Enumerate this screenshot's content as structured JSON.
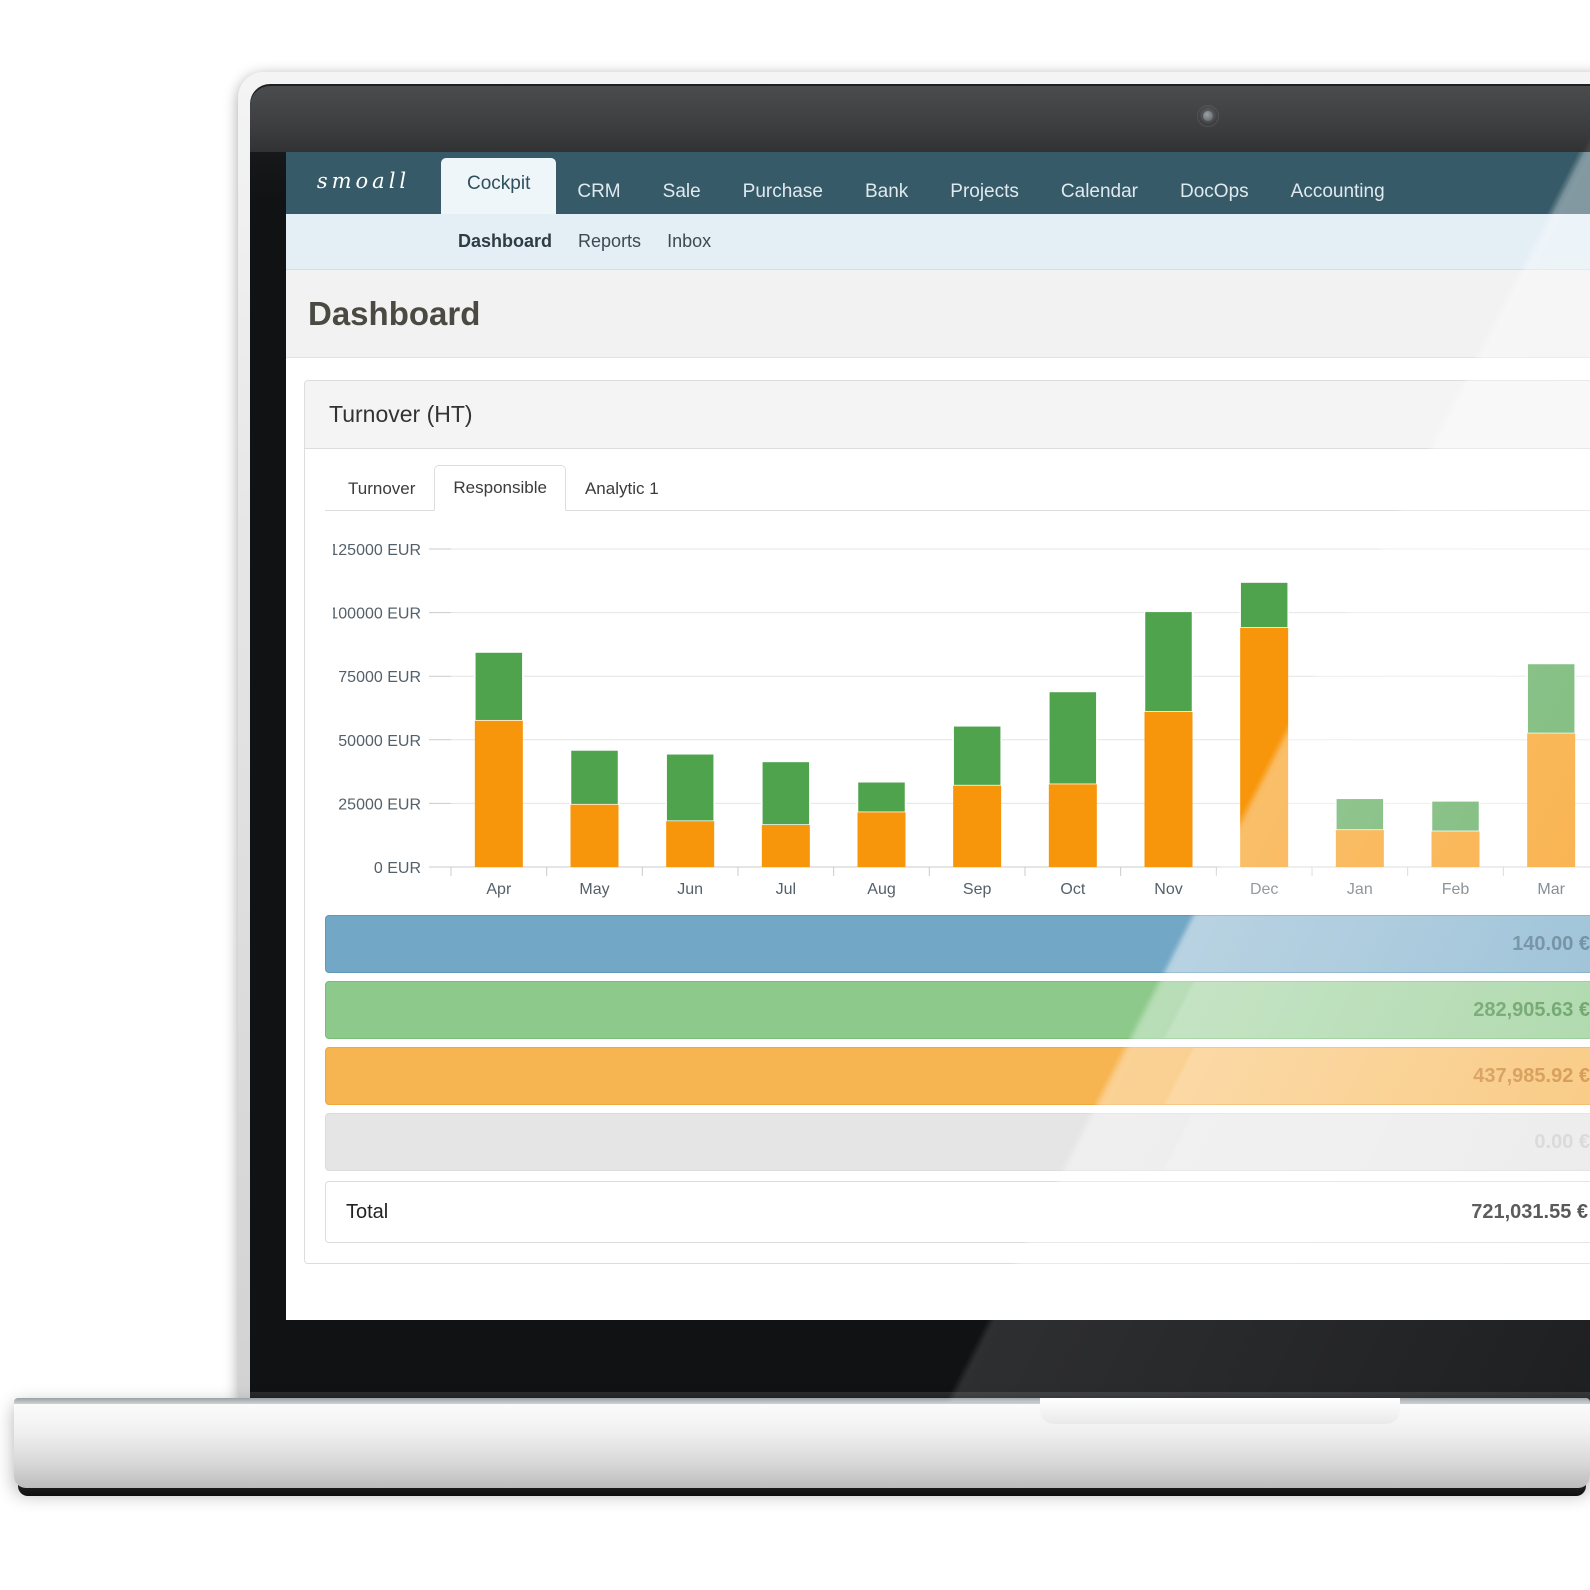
{
  "app": {
    "brand": "smoall",
    "nav_items": [
      {
        "label": "Cockpit",
        "active": true
      },
      {
        "label": "CRM",
        "active": false
      },
      {
        "label": "Sale",
        "active": false
      },
      {
        "label": "Purchase",
        "active": false
      },
      {
        "label": "Bank",
        "active": false
      },
      {
        "label": "Projects",
        "active": false
      },
      {
        "label": "Calendar",
        "active": false
      },
      {
        "label": "DocOps",
        "active": false
      },
      {
        "label": "Accounting",
        "active": false
      }
    ],
    "subnav_items": [
      {
        "label": "Dashboard",
        "active": true
      },
      {
        "label": "Reports",
        "active": false
      },
      {
        "label": "Inbox",
        "active": false
      }
    ]
  },
  "page": {
    "title": "Dashboard"
  },
  "panel": {
    "title": "Turnover (HT)",
    "tabs": [
      {
        "label": "Turnover",
        "active": false
      },
      {
        "label": "Responsible",
        "active": true
      },
      {
        "label": "Analytic 1",
        "active": false
      }
    ]
  },
  "summary": {
    "rows": [
      {
        "value": "140.00 €",
        "color": "#72a7c6",
        "style": "blue"
      },
      {
        "value": "282,905.63 €",
        "color": "#8cc98a",
        "style": "green"
      },
      {
        "value": "437,985.92 €",
        "color": "#f7b551",
        "style": "orange"
      },
      {
        "value": "0.00 €",
        "color": "#e5e5e5",
        "style": "grey"
      }
    ],
    "total_label": "Total",
    "total_value": "721,031.55 €"
  },
  "chart_data": {
    "type": "bar",
    "stacked": true,
    "title": "Turnover (HT)",
    "xlabel": "",
    "ylabel": "EUR",
    "unit": "EUR",
    "grid": true,
    "legend": "none",
    "ylim": [
      0,
      125000
    ],
    "yticks": [
      0,
      25000,
      50000,
      75000,
      100000,
      125000
    ],
    "ytick_labels": [
      "0 EUR",
      "25000 EUR",
      "50000 EUR",
      "75000 EUR",
      "100000 EUR",
      "125000 EUR"
    ],
    "categories": [
      "Apr",
      "May",
      "Jun",
      "Jul",
      "Aug",
      "Sep",
      "Oct",
      "Nov",
      "Dec",
      "Jan",
      "Feb",
      "Mar"
    ],
    "series": [
      {
        "name": "Orange",
        "color": "#f7960b",
        "values": [
          57500,
          24500,
          18000,
          16500,
          21500,
          32000,
          32500,
          61000,
          94000,
          14500,
          14000,
          52500
        ]
      },
      {
        "name": "Green",
        "color": "#4ea34c",
        "values": [
          27000,
          21500,
          26500,
          25000,
          12000,
          23500,
          36500,
          39500,
          18000,
          12500,
          12000,
          27500
        ]
      }
    ],
    "totals": [
      84500,
      46000,
      44500,
      41500,
      33500,
      55500,
      69000,
      100500,
      112000,
      27000,
      26000,
      80000
    ]
  }
}
